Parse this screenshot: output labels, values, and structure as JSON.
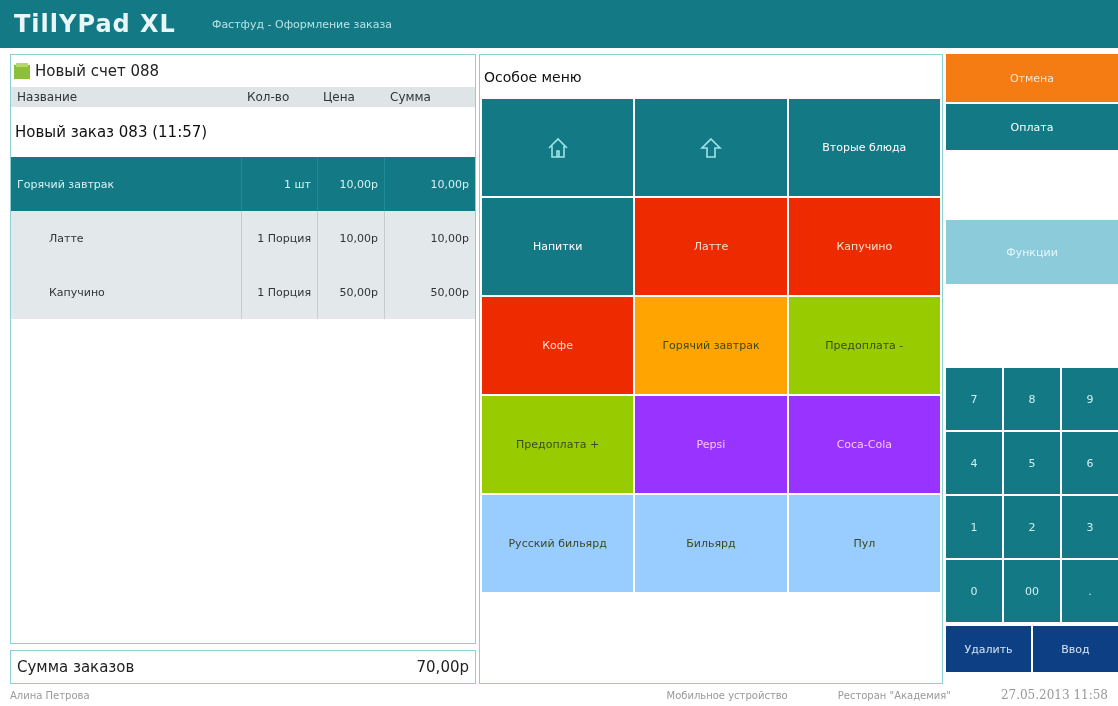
{
  "header": {
    "logo": "TillYPad XL",
    "title": "Фастфуд - Оформление заказа"
  },
  "order": {
    "title": "Новый счет 088",
    "columns": [
      "Название",
      "Кол-во",
      "Цена",
      "Сумма"
    ],
    "group": "Новый заказ 083 (11:57)",
    "rows": [
      {
        "name": "Горячий завтрак",
        "qty": "1 шт",
        "price": "10,00р",
        "sum": "10,00р",
        "selected": true,
        "kind": "item"
      },
      {
        "name": "Латте",
        "qty": "1 Порция",
        "price": "10,00р",
        "sum": "10,00р",
        "selected": false,
        "kind": "modifier"
      },
      {
        "name": "Капучино",
        "qty": "1 Порция",
        "price": "50,00р",
        "sum": "50,00р",
        "selected": false,
        "kind": "modifier"
      }
    ],
    "total_label": "Сумма заказов",
    "total": "70,00р"
  },
  "menu": {
    "title": "Особое меню",
    "tiles": [
      {
        "kind": "home",
        "color": "#127985"
      },
      {
        "kind": "up",
        "color": "#127985"
      },
      {
        "kind": "text",
        "label": "Вторые блюда",
        "color": "#127985"
      },
      {
        "kind": "text",
        "label": "Напитки",
        "color": "#127985"
      },
      {
        "kind": "text",
        "label": "Латте",
        "color": "#ee2a00"
      },
      {
        "kind": "text",
        "label": "Капучино",
        "color": "#ee2a00"
      },
      {
        "kind": "text",
        "label": "Кофе",
        "color": "#ee2a00"
      },
      {
        "kind": "text",
        "label": "Горячий завтрак",
        "color": "#ffa400"
      },
      {
        "kind": "text",
        "label": "Предоплата -",
        "color": "#99cc00"
      },
      {
        "kind": "text",
        "label": "Предоплата +",
        "color": "#99cc00"
      },
      {
        "kind": "text",
        "label": "Pepsi",
        "color": "#9933ff"
      },
      {
        "kind": "text",
        "label": "Coca-Cola",
        "color": "#9933ff"
      },
      {
        "kind": "text",
        "label": "Русский бильярд",
        "color": "#99ccff"
      },
      {
        "kind": "text",
        "label": "Бильярд",
        "color": "#99ccff"
      },
      {
        "kind": "text",
        "label": "Пул",
        "color": "#99ccff"
      }
    ]
  },
  "actions": {
    "cancel": "Отмена",
    "pay": "Оплата",
    "functions": "Функции"
  },
  "keypad": [
    "7",
    "8",
    "9",
    "4",
    "5",
    "6",
    "1",
    "2",
    "3",
    "0",
    "00",
    "."
  ],
  "keypad_actions": [
    "Удалить",
    "Ввод"
  ],
  "status_bar": {
    "user": "Алина Петрова",
    "device": "Мобильное устройство",
    "restaurant": "Ресторан \"Академия\"",
    "datetime": "27.05.2013 11:58"
  }
}
